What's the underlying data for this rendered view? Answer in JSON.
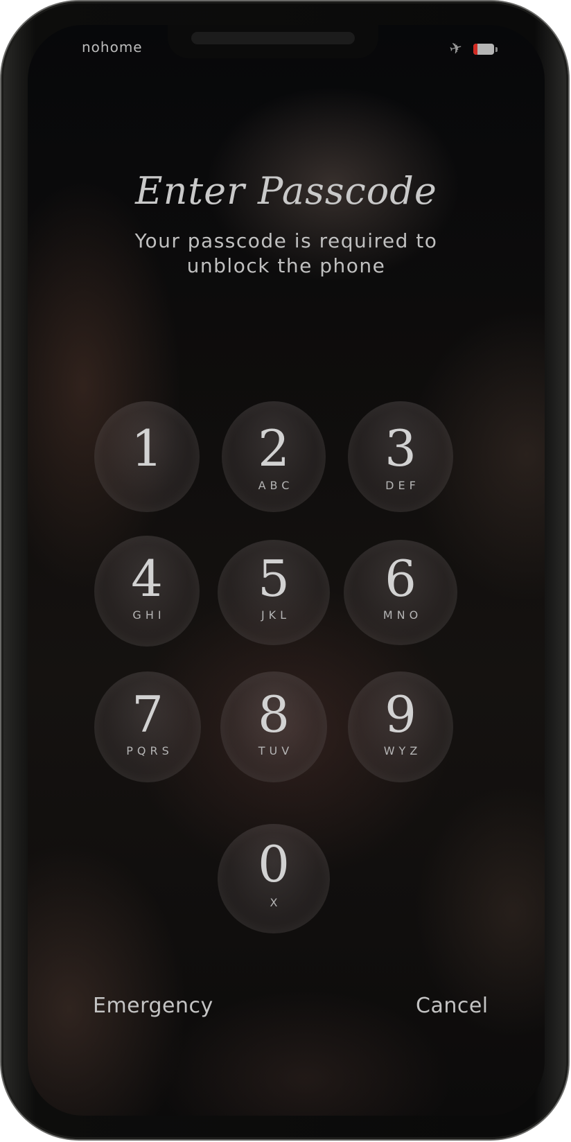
{
  "status_bar": {
    "carrier": "nohome",
    "airplane_icon": "airplane-icon",
    "battery_level": 0.2,
    "battery_color": "#d12a22"
  },
  "lock_screen": {
    "title": "Enter Passcode",
    "subtitle": "Your passcode is required to unblock the phone"
  },
  "keypad": {
    "keys": [
      {
        "digit": "1",
        "letters": ""
      },
      {
        "digit": "2",
        "letters": "ABC"
      },
      {
        "digit": "3",
        "letters": "DEF"
      },
      {
        "digit": "4",
        "letters": "GHI"
      },
      {
        "digit": "5",
        "letters": "JKL"
      },
      {
        "digit": "6",
        "letters": "MNO"
      },
      {
        "digit": "7",
        "letters": "PQRS"
      },
      {
        "digit": "8",
        "letters": "TUV"
      },
      {
        "digit": "9",
        "letters": "WYZ"
      },
      {
        "digit": "0",
        "letters": "X"
      }
    ]
  },
  "footer": {
    "emergency": "Emergency",
    "cancel": "Cancel"
  }
}
